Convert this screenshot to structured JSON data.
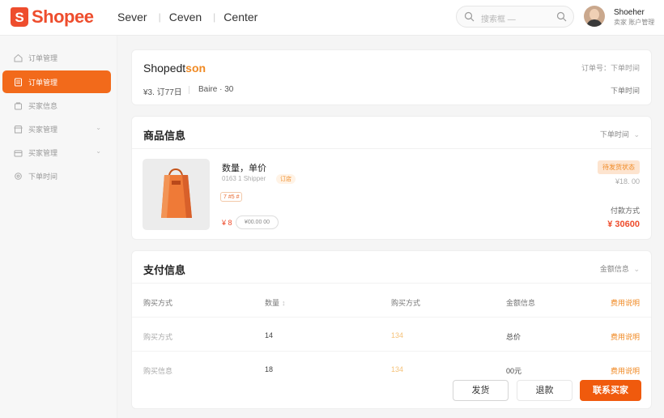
{
  "header": {
    "logo_letter": "S",
    "logo_text": "Shopee",
    "nav": [
      "Sever",
      "Ceven",
      "Center"
    ],
    "search_placeholder": "搜索框 —",
    "user_name": "Shoeher",
    "user_role": "卖家 账户管理"
  },
  "sidebar": {
    "items": [
      {
        "label": "订单管理",
        "icon": "home-icon",
        "active": false,
        "chevron": false
      },
      {
        "label": "订单管理",
        "icon": "order-icon",
        "active": true,
        "chevron": false
      },
      {
        "label": "买家信息",
        "icon": "bag-icon",
        "active": false,
        "chevron": false
      },
      {
        "label": "买家管理",
        "icon": "store-icon",
        "active": false,
        "chevron": true
      },
      {
        "label": "买家管理",
        "icon": "box-icon",
        "active": false,
        "chevron": true
      },
      {
        "label": "下单时间",
        "icon": "gear-icon",
        "active": false,
        "chevron": false
      }
    ]
  },
  "order_summary": {
    "title_prefix": "Shopedt",
    "title_accent": "son",
    "order_no_label": "订单号：下单时间",
    "sub_left": "¥3. 订77日",
    "sub_mid": "Baire · 30",
    "order_time_label": "下单时间"
  },
  "product_section": {
    "title": "商品信息",
    "dropdown_label": "下单时间",
    "product_name": "数量，单价",
    "product_meta": "0163 1 Shipper",
    "product_tag": "订店",
    "mini_tag": "7 #5 #",
    "price_label": "¥ 8",
    "pill_label": "¥00.00 00",
    "status_badge": "待发货状态",
    "unit_price": "¥18. 00",
    "payment_label": "付款方式",
    "total_price": "¥ 30600"
  },
  "payment_section": {
    "title": "支付信息",
    "dropdown_label": "金额信息",
    "columns": [
      "购买方式",
      "数量",
      "购买方式",
      "金额信息",
      "费用说明"
    ],
    "rows": [
      [
        "购买方式",
        "14",
        "134",
        "总价",
        "费用说明"
      ],
      [
        "购买信息",
        "18",
        "134",
        "00元",
        "费用说明"
      ]
    ]
  },
  "actions": {
    "ship": "发货",
    "refund": "退款",
    "contact": "联系买家"
  },
  "colors": {
    "brand": "#ee4d2d",
    "active_nav": "#f26a1b",
    "accent": "#f08a24"
  }
}
